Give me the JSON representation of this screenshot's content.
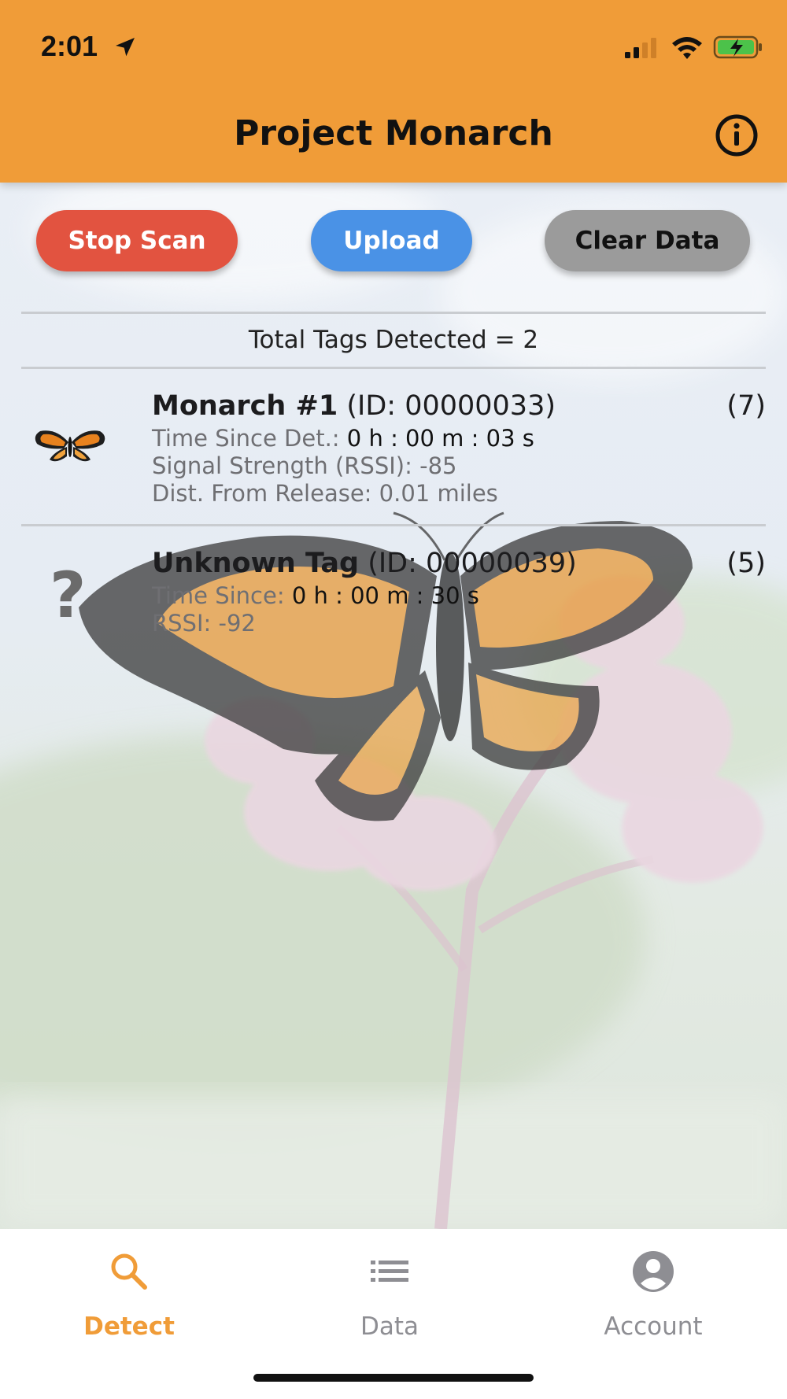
{
  "status_bar": {
    "time": "2:01"
  },
  "header": {
    "title": "Project Monarch"
  },
  "actions": {
    "stop_scan": "Stop Scan",
    "upload": "Upload",
    "clear_data": "Clear Data"
  },
  "summary": {
    "total_tags": "Total Tags Detected = 2"
  },
  "tags": [
    {
      "name": "Monarch #1",
      "id": "(ID: 00000033)",
      "count": "(7)",
      "line1_label": "Time Since Det.:",
      "line1_value": "0 h : 00 m : 03 s",
      "line2": "Signal Strength (RSSI): -85",
      "line3": "Dist. From Release: 0.01 miles",
      "icon": "monarch-butterfly-icon"
    },
    {
      "name": "Unknown Tag",
      "id": "(ID: 00000039)",
      "count": "(5)",
      "line1_label": "Time Since:",
      "line1_value": "0 h : 00 m : 30 s",
      "line2": "RSSI: -92",
      "icon": "question-mark-icon",
      "glyph": "?"
    }
  ],
  "tabs": [
    {
      "label": "Detect",
      "icon": "search-icon",
      "active": true
    },
    {
      "label": "Data",
      "icon": "list-icon",
      "active": false
    },
    {
      "label": "Account",
      "icon": "account-icon",
      "active": false
    }
  ],
  "colors": {
    "header": "#f09c38",
    "stop": "#e25340",
    "upload": "#4a92e6",
    "clear": "#9b9b9b",
    "active_tab": "#f09c38"
  }
}
